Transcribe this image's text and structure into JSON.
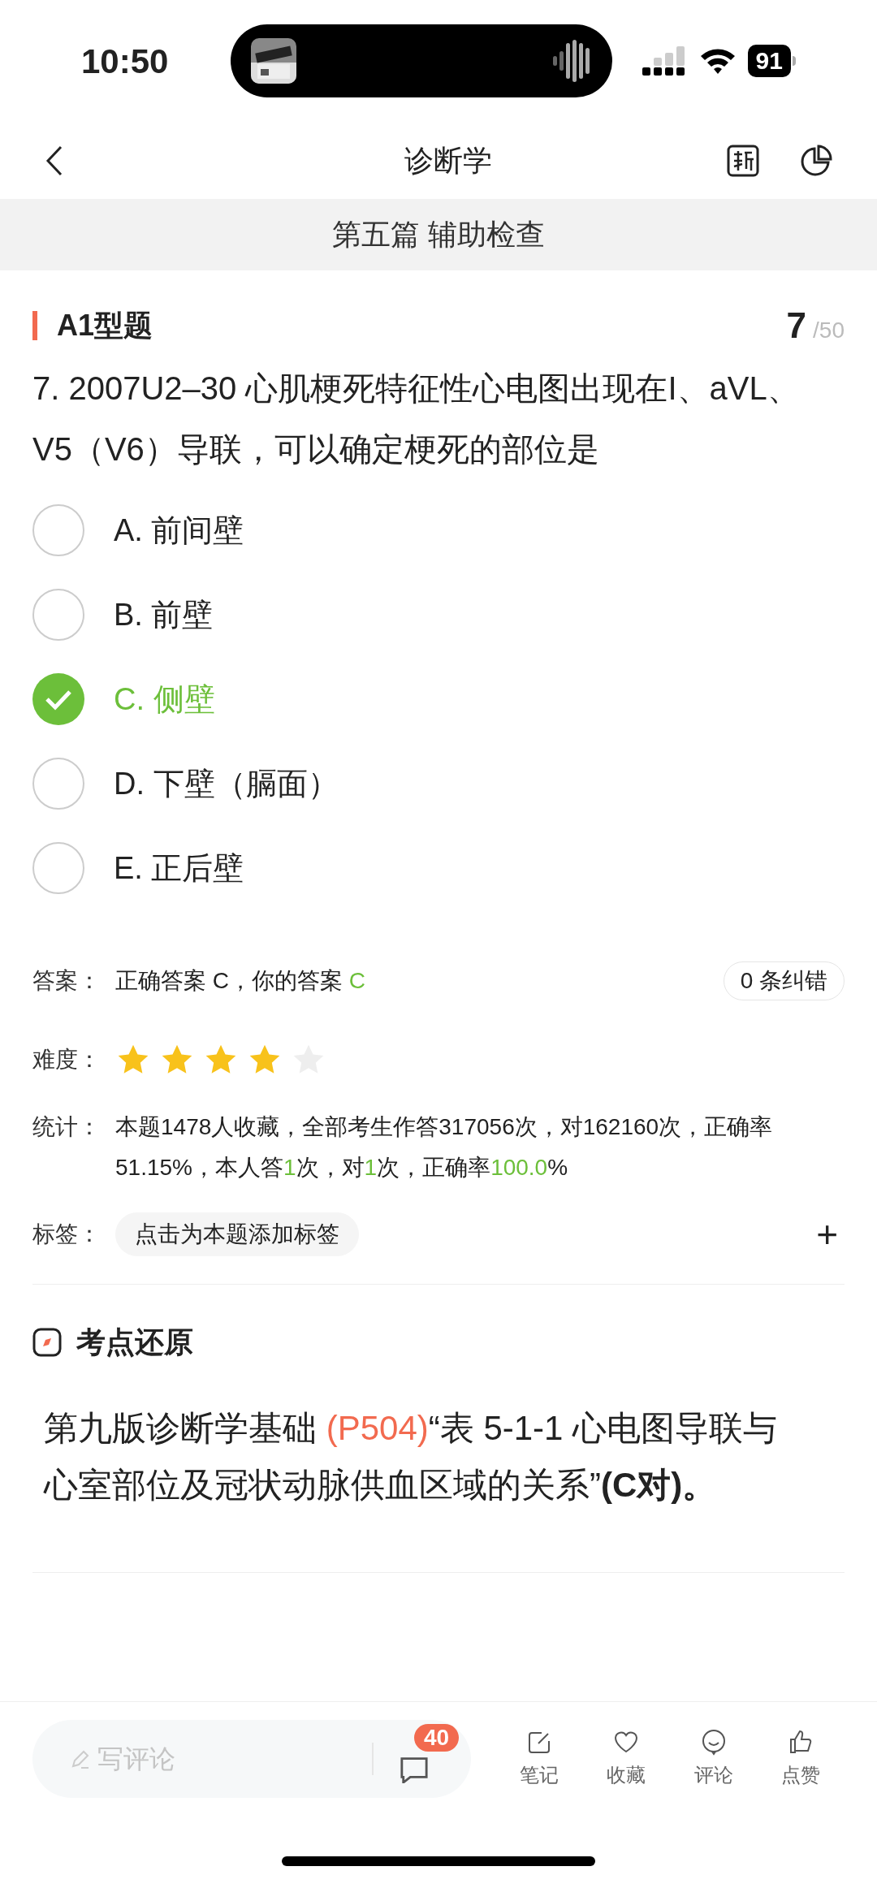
{
  "status_bar": {
    "time": "10:50",
    "battery": "91"
  },
  "nav": {
    "title": "诊断学"
  },
  "chapter": "第五篇 辅助检查",
  "section": {
    "title": "A1型题",
    "current": "7",
    "total": "/50"
  },
  "question": "7. 2007U2–30 心肌梗死特征性心电图出现在I、aVL、V5（V6）导联，可以确定梗死的部位是",
  "options": [
    {
      "label": "A. 前间壁",
      "selected": false
    },
    {
      "label": "B. 前壁",
      "selected": false
    },
    {
      "label": "C. 侧壁",
      "selected": true
    },
    {
      "label": "D. 下壁（膈面）",
      "selected": false
    },
    {
      "label": "E. 正后壁",
      "selected": false
    }
  ],
  "answer": {
    "label": "答案：",
    "segments": [
      {
        "text": "正确答案 C，你的答案 ",
        "highlight": false
      },
      {
        "text": "C",
        "highlight": true
      }
    ],
    "errata": "0 条纠错"
  },
  "difficulty": {
    "label": "难度：",
    "stars": 4
  },
  "stats": {
    "label": "统计：",
    "segments": [
      {
        "text": "本题1478人收藏，全部考生作答317056次，对162160次，正确率51.15%，本人答",
        "highlight": false
      },
      {
        "text": "1",
        "highlight": true
      },
      {
        "text": "次，对",
        "highlight": false
      },
      {
        "text": "1",
        "highlight": true
      },
      {
        "text": "次，正确率",
        "highlight": false
      },
      {
        "text": "100.0",
        "highlight": true
      },
      {
        "text": "%",
        "highlight": false
      }
    ]
  },
  "tags": {
    "label": "标签：",
    "placeholder": "点击为本题添加标签",
    "add": "+"
  },
  "point": {
    "title": "考点还原",
    "segments": [
      {
        "text": "第九版诊断学基础 ",
        "kind": "plain"
      },
      {
        "text": "(P504)",
        "kind": "ref"
      },
      {
        "text": "“表 5-1-1 心电图导联与心室部位及冠状动脉供血区域的关系”",
        "kind": "plain"
      },
      {
        "text": "(C对)。",
        "kind": "bold"
      }
    ]
  },
  "bottom_bar": {
    "comment_placeholder": "写评论",
    "comment_count": "40",
    "actions": [
      "笔记",
      "收藏",
      "评论",
      "点赞"
    ]
  }
}
